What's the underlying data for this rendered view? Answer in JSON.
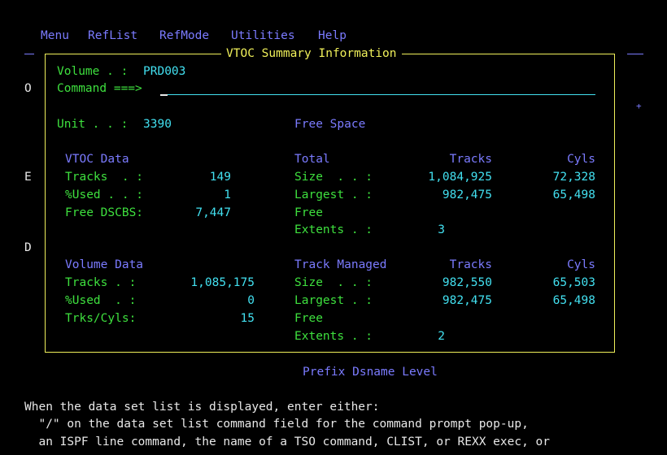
{
  "menu": [
    "Menu",
    "RefList",
    "RefMode",
    "Utilities",
    "Help"
  ],
  "background": {
    "left_letters": [
      "O",
      "E",
      "D"
    ],
    "right_mark": "+",
    "prefix_heading": "Prefix Dsname Level",
    "help_lines": [
      "When the data set list is displayed, enter either:",
      "  \"/\" on the data set list command field for the command prompt pop-up,",
      "  an ISPF line command, the name of a TSO command, CLIST, or REXX exec, or"
    ]
  },
  "popup": {
    "title": "VTOC Summary Information",
    "volume_label": "Volume . :",
    "volume_value": "PRD003",
    "command_label": "Command ===>",
    "command_value": "",
    "unit_label": "Unit . . :",
    "unit_value": "3390",
    "free_space_heading": "Free Space",
    "vtoc": {
      "heading": "VTOC Data",
      "tracks_label": "Tracks  . :",
      "tracks_value": "149",
      "used_label": "%Used . . :",
      "used_value": "1",
      "free_label": "Free DSCBS:",
      "free_value": "7,447"
    },
    "volume_data": {
      "heading": "Volume Data",
      "tracks_label": "Tracks . :",
      "tracks_value": "1,085,175",
      "used_label": "%Used  . :",
      "used_value": "0",
      "trks_label": "Trks/Cyls:",
      "trks_value": "15"
    },
    "total": {
      "heading": "Total",
      "col_tracks": "Tracks",
      "col_cyls": "Cyls",
      "size_label": "Size  . . :",
      "size_tracks": "1,084,925",
      "size_cyls": "72,328",
      "largest_label": "Largest . :",
      "largest_tracks": "982,475",
      "largest_cyls": "65,498",
      "free_label": "Free",
      "extents_label": "Extents . :",
      "extents_value": "3"
    },
    "track_managed": {
      "heading": "Track Managed",
      "col_tracks": "Tracks",
      "col_cyls": "Cyls",
      "size_label": "Size  . . :",
      "size_tracks": "982,550",
      "size_cyls": "65,503",
      "largest_label": "Largest . :",
      "largest_tracks": "982,475",
      "largest_cyls": "65,498",
      "free_label": "Free",
      "extents_label": "Extents . :",
      "extents_value": "2"
    }
  }
}
